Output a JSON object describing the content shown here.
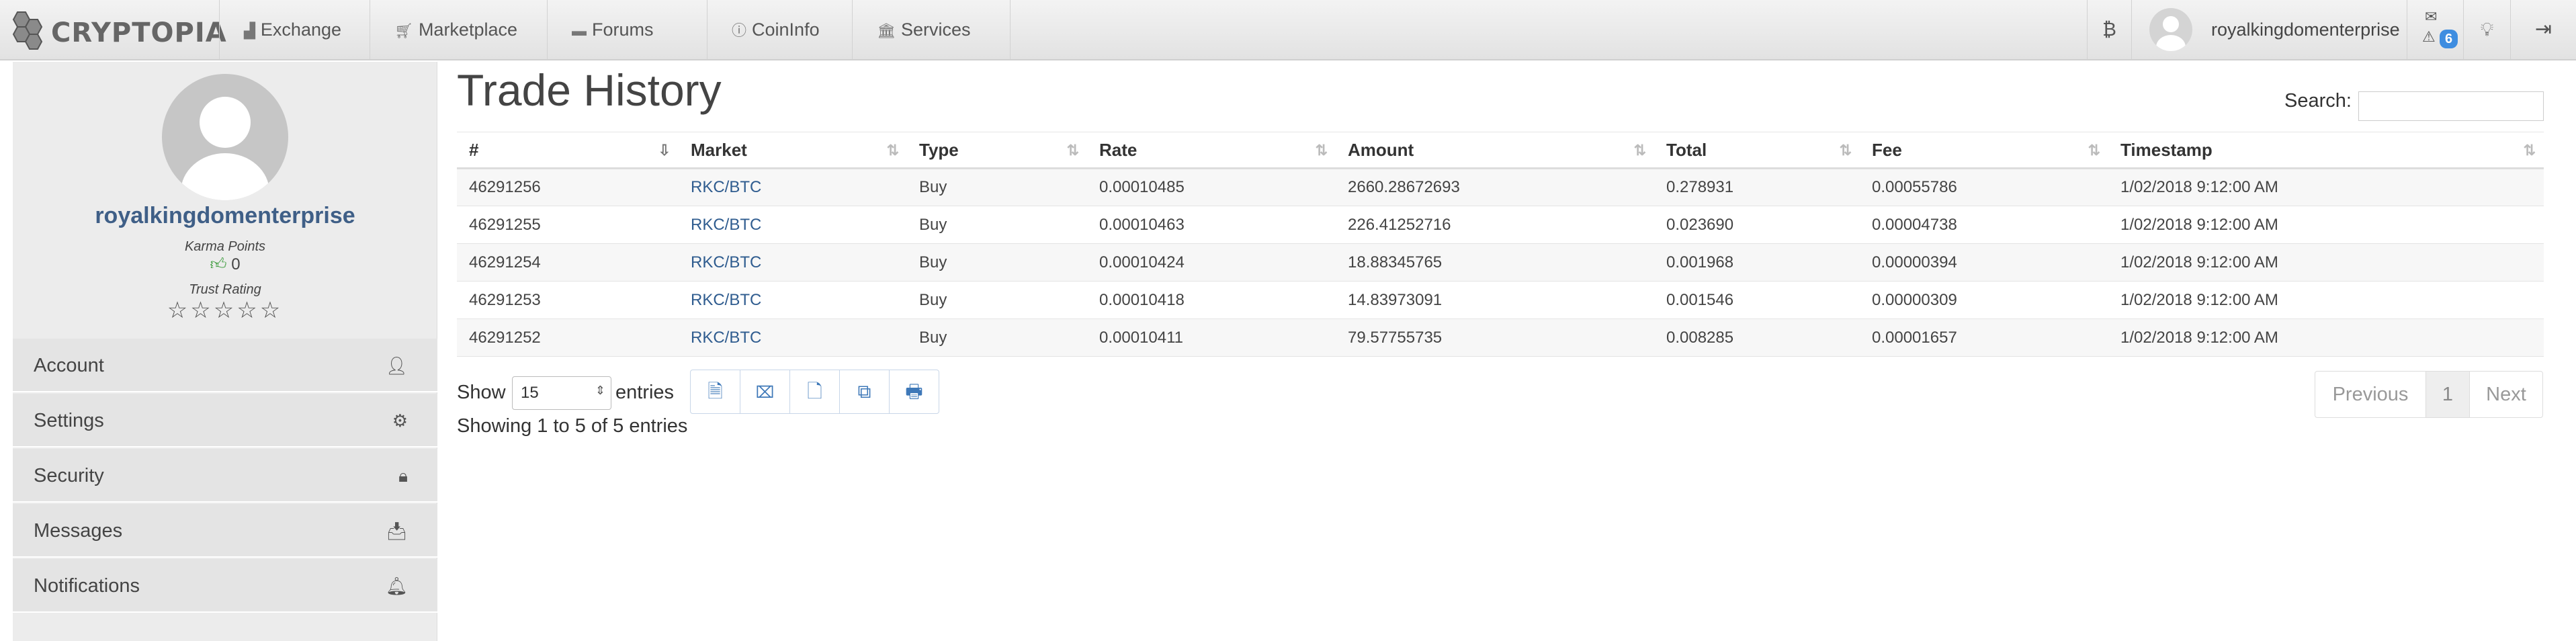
{
  "nav": {
    "brand": "CRYPTOPIA",
    "items": [
      {
        "label": "Exchange",
        "icon": "chart-icon"
      },
      {
        "label": "Marketplace",
        "icon": "cart-icon"
      },
      {
        "label": "Forums",
        "icon": "comments-icon"
      },
      {
        "label": "CoinInfo",
        "icon": "info-icon"
      },
      {
        "label": "Services",
        "icon": "bank-icon"
      }
    ],
    "username": "royalkingdomenterprise",
    "notification_count": "6"
  },
  "profile": {
    "name": "royalkingdomenterprise",
    "karma_label": "Karma Points",
    "karma_value": "0",
    "trust_label": "Trust Rating",
    "trust_stars": "☆☆☆☆☆",
    "trust_rating": 0
  },
  "sidebar": {
    "items": [
      {
        "label": "Account",
        "icon": "user-icon"
      },
      {
        "label": "Settings",
        "icon": "gear-icon"
      },
      {
        "label": "Security",
        "icon": "lock-icon"
      },
      {
        "label": "Messages",
        "icon": "inbox-icon"
      },
      {
        "label": "Notifications",
        "icon": "bell-icon"
      }
    ]
  },
  "main": {
    "title": "Trade History",
    "search_label": "Search:",
    "search_value": "",
    "columns": [
      "#",
      "Market",
      "Type",
      "Rate",
      "Amount",
      "Total",
      "Fee",
      "Timestamp"
    ],
    "rows": [
      [
        "46291256",
        "RKC/BTC",
        "Buy",
        "0.00010485",
        "2660.28672693",
        "0.278931",
        "0.00055786",
        "1/02/2018 9:12:00 AM"
      ],
      [
        "46291255",
        "RKC/BTC",
        "Buy",
        "0.00010463",
        "226.41252716",
        "0.023690",
        "0.00004738",
        "1/02/2018 9:12:00 AM"
      ],
      [
        "46291254",
        "RKC/BTC",
        "Buy",
        "0.00010424",
        "18.88345765",
        "0.001968",
        "0.00000394",
        "1/02/2018 9:12:00 AM"
      ],
      [
        "46291253",
        "RKC/BTC",
        "Buy",
        "0.00010418",
        "14.83973091",
        "0.001546",
        "0.00000309",
        "1/02/2018 9:12:00 AM"
      ],
      [
        "46291252",
        "RKC/BTC",
        "Buy",
        "0.00010411",
        "79.57755735",
        "0.008285",
        "0.00001657",
        "1/02/2018 9:12:00 AM"
      ]
    ],
    "show_label": "Show",
    "page_size": "15",
    "entries_label": "entries",
    "export_buttons": [
      "csv-icon",
      "excel-icon",
      "pdf-icon",
      "copy-icon",
      "print-icon"
    ],
    "showing_text": "Showing 1 to 5 of 5 entries",
    "pager": {
      "previous": "Previous",
      "current": "1",
      "next": "Next"
    }
  },
  "colors": {
    "link": "#2f5c8f",
    "profile_name": "#3f5f87",
    "badge": "#3e8de0",
    "navbar": "#e6e6e6",
    "sidebar": "#ececec"
  }
}
